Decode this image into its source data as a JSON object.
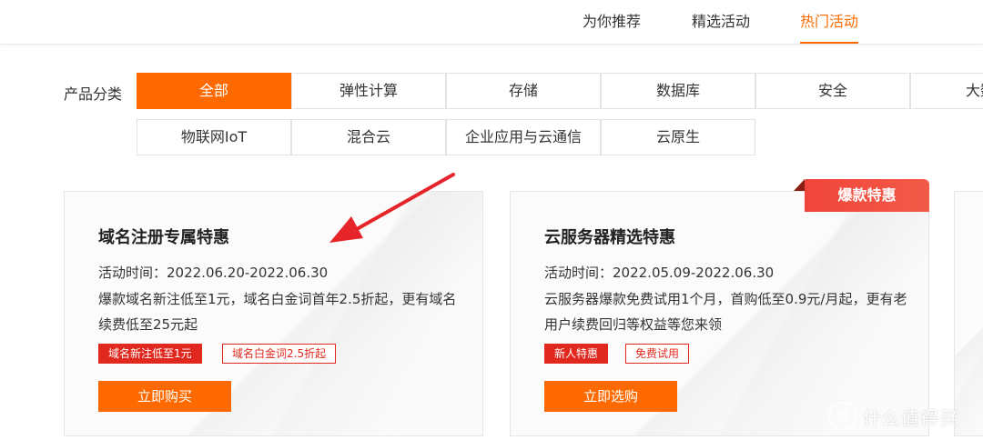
{
  "top_tabs": [
    {
      "label": "为你推荐"
    },
    {
      "label": "精选活动"
    },
    {
      "label": "热门活动"
    }
  ],
  "category": {
    "label": "产品分类",
    "row1": [
      "全部",
      "弹性计算",
      "存储",
      "数据库",
      "安全",
      "大数"
    ],
    "row2": [
      "物联网IoT",
      "混合云",
      "企业应用与云通信",
      "云原生"
    ]
  },
  "cards": [
    {
      "title": "域名注册专属特惠",
      "time": "活动时间：2022.06.20-2022.06.30",
      "desc": "爆款域名新注低至1元，域名白金词首年2.5折起，更有域名续费低至25元起",
      "tags": [
        "域名新注低至1元",
        "域名白金词2.5折起"
      ],
      "button": "立即购买"
    },
    {
      "title": "云服务器精选特惠",
      "time": "活动时间：2022.05.09-2022.06.30",
      "desc": "云服务器爆款免费试用1个月，首购低至0.9元/月起，更有老用户续费回归等权益等您来领",
      "tags": [
        "新人特惠",
        "免费试用"
      ],
      "button": "立即选购",
      "badge": "爆款特惠"
    }
  ],
  "watermark": {
    "logo": "值",
    "text": "什么值得买"
  },
  "colors": {
    "accent": "#ff6a00",
    "tag_red": "#e0281e",
    "arrow_red": "#e5252a"
  }
}
